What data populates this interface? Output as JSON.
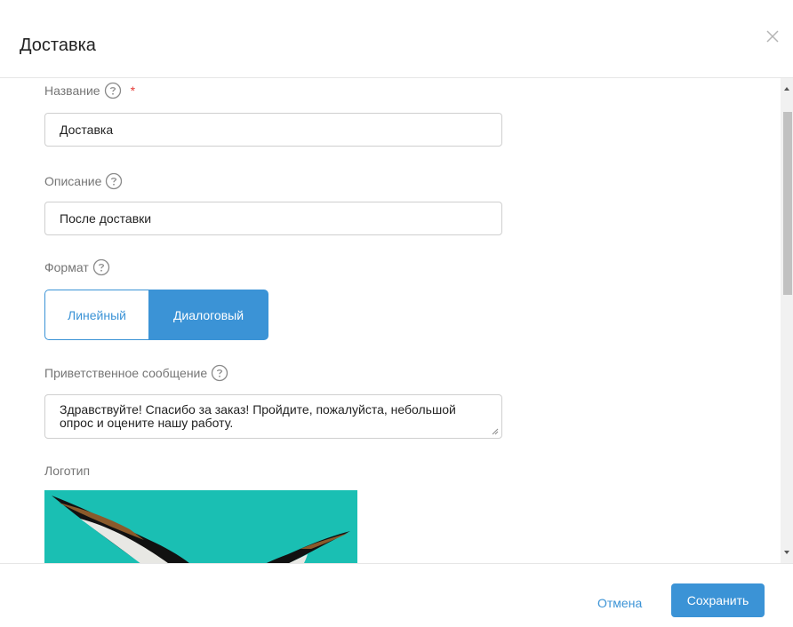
{
  "dialog": {
    "title": "Доставка",
    "close_icon": "close-icon"
  },
  "form": {
    "name": {
      "label": "Название",
      "required_mark": "*",
      "value": "Доставка"
    },
    "description": {
      "label": "Описание",
      "value": "После доставки"
    },
    "format": {
      "label": "Формат",
      "options": [
        "Линейный",
        "Диалоговый"
      ],
      "selected": "Диалоговый"
    },
    "welcome": {
      "label": "Приветственное сообщение",
      "value": "Здравствуйте! Спасибо за заказ! Пройдите, пожалуйста, небольшой опрос и оцените нашу работу."
    },
    "logo": {
      "label": "Логотип"
    }
  },
  "footer": {
    "cancel_label": "Отмена",
    "save_label": "Сохранить"
  },
  "colors": {
    "accent": "#3b93d6",
    "logo_bg": "#1abfb3",
    "required": "#e53935"
  }
}
